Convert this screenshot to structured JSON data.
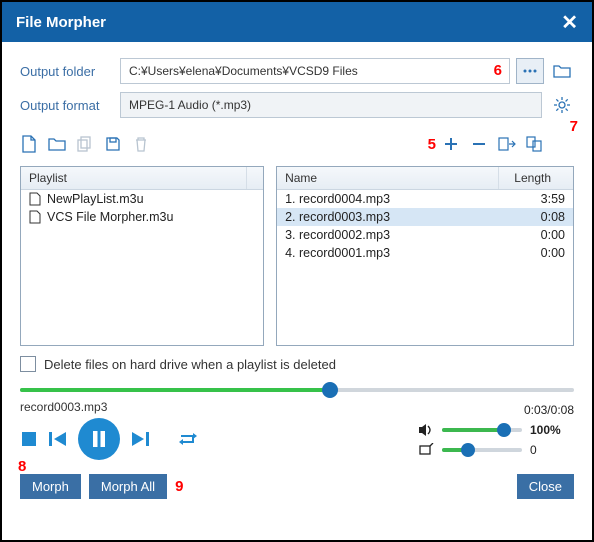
{
  "title": "File Morpher",
  "labels": {
    "output_folder": "Output folder",
    "output_format": "Output format"
  },
  "output_folder": "C:¥Users¥elena¥Documents¥VCSD9 Files",
  "output_format": "MPEG-1 Audio (*.mp3)",
  "annotations": {
    "a5": "5",
    "a6": "6",
    "a7": "7",
    "a8": "8",
    "a9": "9"
  },
  "playlist": {
    "header": "Playlist",
    "items": [
      "NewPlayList.m3u",
      "VCS File Morpher.m3u"
    ]
  },
  "tracks": {
    "name_header": "Name",
    "length_header": "Length",
    "rows": [
      {
        "idx": "1.",
        "name": "record0004.mp3",
        "length": "3:59",
        "selected": false
      },
      {
        "idx": "2.",
        "name": "record0003.mp3",
        "length": "0:08",
        "selected": true
      },
      {
        "idx": "3.",
        "name": "record0002.mp3",
        "length": "0:00",
        "selected": false
      },
      {
        "idx": "4.",
        "name": "record0001.mp3",
        "length": "0:00",
        "selected": false
      }
    ]
  },
  "checkbox_label": "Delete files on hard drive when a playlist is deleted",
  "player": {
    "track": "record0003.mp3",
    "time": "0:03/0:08",
    "progress_pct": 56,
    "volume_label": "100%",
    "volume_pct": 78,
    "pitch_label": "0",
    "pitch_pct": 32
  },
  "buttons": {
    "morph": "Morph",
    "morph_all": "Morph All",
    "close": "Close"
  }
}
